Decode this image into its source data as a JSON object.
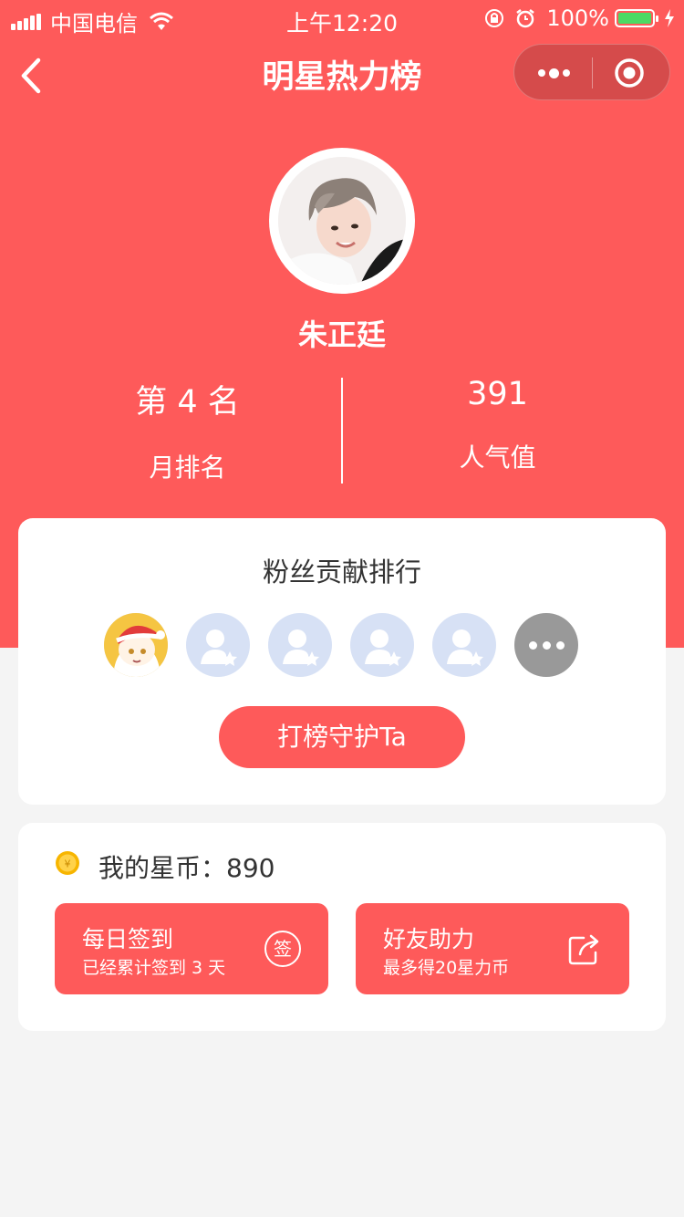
{
  "status_bar": {
    "carrier": "中国电信",
    "time": "上午12:20",
    "battery_percent": "100%",
    "battery_level": 1.0
  },
  "nav": {
    "title": "明星热力榜"
  },
  "star": {
    "name": "朱正廷",
    "rank_value": "第 4 名",
    "rank_label": "月排名",
    "popularity_value": "391",
    "popularity_label": "人气值"
  },
  "fans": {
    "title": "粉丝贡献排行",
    "button_label": "打榜守护Ta"
  },
  "coins": {
    "text": "我的星币：890",
    "coin_symbol": "¥",
    "daily": {
      "title": "每日签到",
      "subtitle": "已经累计签到 3 天",
      "icon_text": "签"
    },
    "friend": {
      "title": "好友助力",
      "subtitle": "最多得20星力币"
    }
  },
  "colors": {
    "accent": "#fe5a5a",
    "placeholder_avatar": "#d7e1f5",
    "more_avatar": "#999999",
    "battery": "#4cd964"
  }
}
